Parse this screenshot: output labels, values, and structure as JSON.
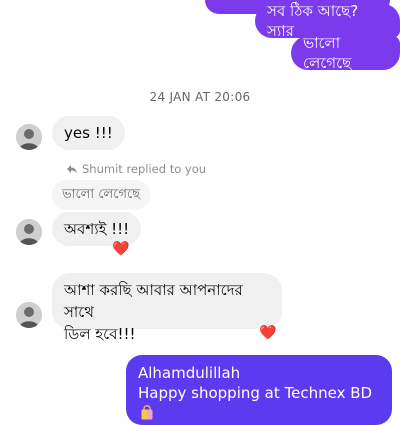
{
  "messages_top": {
    "out1": "সব ঠিক আছে? স্যার",
    "out2": "ভালো লেগেছে"
  },
  "timestamp": "24 JAN AT 20:06",
  "incoming": {
    "msg1": "yes !!!",
    "reply_note": "Shumit replied to you",
    "quoted": "ভালো লেগেছে",
    "msg2": "অবশ্যই !!!",
    "msg3_line1": "আশা করছি আবার আপনাদের সাথে",
    "msg3_line2": "ডিল হবে!!!",
    "reaction": "❤️"
  },
  "outgoing_bottom": {
    "line1": "Alhamdulillah",
    "line2": "Happy shopping at Technex BD"
  },
  "colors": {
    "outgoing": "#7c3aed",
    "outgoing_alt": "#5b3bf0",
    "incoming": "#f0f0f0",
    "heart": "#e41e3f"
  },
  "icons": {
    "reply": "reply-arrow-icon",
    "bag": "shopping-bag-icon",
    "reaction": "heart-icon"
  }
}
